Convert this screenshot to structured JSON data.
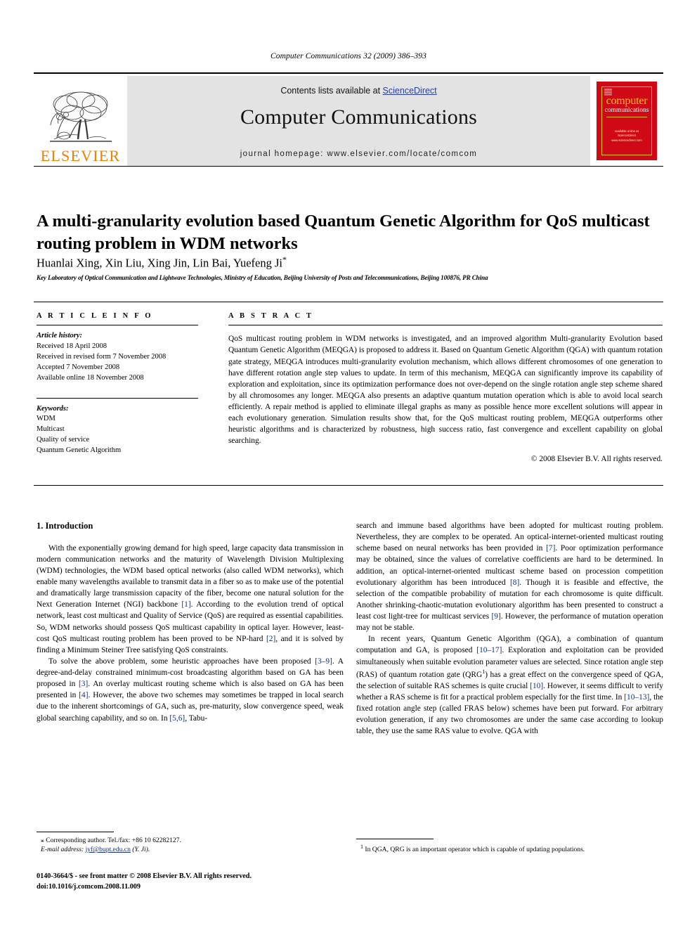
{
  "running_head": "Computer Communications 32 (2009) 386–393",
  "masthead": {
    "publisher_name": "ELSEVIER",
    "contents_prefix": "Contents lists available at ",
    "contents_link": "ScienceDirect",
    "journal_title": "Computer Communications",
    "homepage": "journal homepage: www.elsevier.com/locate/comcom",
    "cover": {
      "word1": "computer",
      "word2": "communications",
      "sciencedirect_line1": "available online at",
      "sciencedirect_line2": "ScienceDirect",
      "sciencedirect_line3": "www.sciencedirect.com"
    },
    "colors": {
      "banner_bg": "#e3e3e3",
      "link_blue": "#2b3f9e",
      "elsevier_orange": "#F08000",
      "cover_red": "#cf0a16",
      "cover_yellow": "#f6c419"
    }
  },
  "article": {
    "title": "A multi-granularity evolution based Quantum Genetic Algorithm for QoS multicast routing problem in WDM networks",
    "authors": "Huanlai Xing, Xin Liu, Xing Jin, Lin Bai, Yuefeng Ji",
    "author_star": "*",
    "affiliation": "Key Laboratory of Optical Communication and Lightwave Technologies, Ministry of Education, Beijing University of Posts and Telecommunications, Beijing 100876, PR China"
  },
  "article_info": {
    "heading": "A R T I C L E   I N F O",
    "history_label": "Article history:",
    "history": [
      "Received 18 April 2008",
      "Received in revised form 7 November 2008",
      "Accepted 7 November 2008",
      "Available online 18 November 2008"
    ],
    "keywords_label": "Keywords:",
    "keywords": [
      "WDM",
      "Multicast",
      "Quality of service",
      "Quantum Genetic Algorithm"
    ]
  },
  "abstract": {
    "heading": "A B S T R A C T",
    "text": "QoS multicast routing problem in WDM networks is investigated, and an improved algorithm Multi-granularity Evolution based Quantum Genetic Algorithm (MEQGA) is proposed to address it. Based on Quantum Genetic Algorithm (QGA) with quantum rotation gate strategy, MEQGA introduces multi-granularity evolution mechanism, which allows different chromosomes of one generation to have different rotation angle step values to update. In term of this mechanism, MEQGA can significantly improve its capability of exploration and exploitation, since its optimization performance does not over-depend on the single rotation angle step scheme shared by all chromosomes any longer. MEQGA also presents an adaptive quantum mutation operation which is able to avoid local search efficiently. A repair method is applied to eliminate illegal graphs as many as possible hence more excellent solutions will appear in each evolutionary generation. Simulation results show that, for the QoS multicast routing problem, MEQGA outperforms other heuristic algorithms and is characterized by robustness, high success ratio, fast convergence and excellent capability on global searching.",
    "copyright": "© 2008 Elsevier B.V. All rights reserved."
  },
  "introduction": {
    "heading": "1. Introduction",
    "left_paragraphs": [
      "With the exponentially growing demand for high speed, large capacity data transmission in modern communication networks and the maturity of Wavelength Division Multiplexing (WDM) technologies, the WDM based optical networks (also called WDM networks), which enable many wavelengths available to transmit data in a fiber so as to make use of the potential and dramatically large transmission capacity of the fiber, become one natural solution for the Next Generation Internet (NGI) backbone [1]. According to the evolution trend of optical network, least cost multicast and Quality of Service (QoS) are required as essential capabilities. So, WDM networks should possess QoS multicast capability in optical layer. However, least-cost QoS multicast routing problem has been proved to be NP-hard [2], and it is solved by finding a Minimum Steiner Tree satisfying QoS constraints.",
      "To solve the above problem, some heuristic approaches have been proposed [3–9]. A degree-and-delay constrained minimum-cost broadcasting algorithm based on GA has been proposed in [3]. An overlay multicast routing scheme which is also based on GA has been presented in [4]. However, the above two schemes may sometimes be trapped in local search due to the inherent shortcomings of GA, such as, pre-maturity, slow convergence speed, weak global searching capability, and so on. In [5,6], Tabu-"
    ],
    "right_paragraphs": [
      "search and immune based algorithms have been adopted for multicast routing problem. Nevertheless, they are complex to be operated. An optical-internet-oriented multicast routing scheme based on neural networks has been provided in [7]. Poor optimization performance may be obtained, since the values of correlative coefficients are hard to be determined. In addition, an optical-internet-oriented multicast scheme based on procession competition evolutionary algorithm has been introduced [8]. Though it is feasible and effective, the selection of the compatible probability of mutation for each chromosome is quite difficult. Another shrinking-chaotic-mutation evolutionary algorithm has been presented to construct a least cost light-tree for multicast services [9]. However, the performance of mutation operation may not be stable.",
      "In recent years, Quantum Genetic Algorithm (QGA), a combination of quantum computation and GA, is proposed [10–17]. Exploration and exploitation can be provided simultaneously when suitable evolution parameter values are selected. Since rotation angle step (RAS) of quantum rotation gate (QRG1) has a great effect on the convergence speed of QGA, the selection of suitable RAS schemes is quite crucial [10]. However, it seems difficult to verify whether a RAS scheme is fit for a practical problem especially for the first time. In [10–13], the fixed rotation angle step (called FRAS below) schemes have been put forward. For arbitrary evolution generation, if any two chromosomes are under the same case according to lookup table, they use the same RAS value to evolve. QGA with"
    ]
  },
  "footnotes": {
    "corresponding": "Corresponding author. Tel./fax: +86 10 62282127.",
    "email_label": "E-mail address:",
    "email": "jyf@bupt.edu.cn",
    "email_suffix": " (Y. Ji).",
    "footnote1_marker": "1",
    "footnote1": "In QGA, QRG is an important operator which is capable of updating populations."
  },
  "issn_footer": {
    "line1": "0140-3664/$ - see front matter © 2008 Elsevier B.V. All rights reserved.",
    "line2": "doi:10.1016/j.comcom.2008.11.009"
  }
}
